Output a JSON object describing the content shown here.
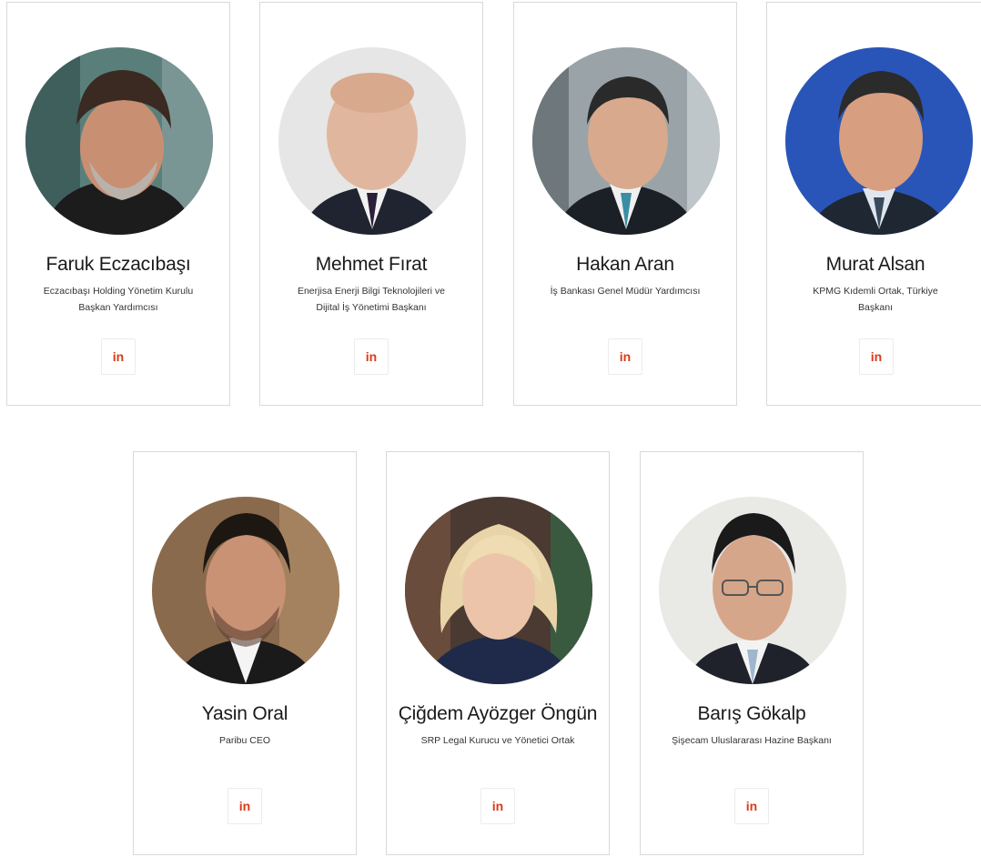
{
  "speakers": [
    {
      "name": "Faruk Eczacıbaşı",
      "title": "Eczacıbaşı Holding Yönetim Kurulu Başkan Yardımcısı",
      "linkedin_label": "in"
    },
    {
      "name": "Mehmet Fırat",
      "title": "Enerjisa Enerji Bilgi Teknolojileri ve Dijital İş Yönetimi Başkanı",
      "linkedin_label": "in"
    },
    {
      "name": "Hakan Aran",
      "title": "İş Bankası Genel Müdür Yardımcısı",
      "linkedin_label": "in"
    },
    {
      "name": "Murat Alsan",
      "title": "KPMG Kıdemli Ortak, Türkiye Başkanı",
      "linkedin_label": "in"
    },
    {
      "name": "Yasin Oral",
      "title": "Paribu CEO",
      "linkedin_label": "in"
    },
    {
      "name": "Çiğdem Ayözger Öngün",
      "title": "SRP Legal Kurucu ve Yönetici Ortak",
      "linkedin_label": "in"
    },
    {
      "name": "Barış Gökalp",
      "title": "Şişecam Uluslararası Hazine Başkanı",
      "linkedin_label": "in"
    }
  ],
  "colors": {
    "linkedin_accent": "#d93a1a",
    "card_border": "#d9d9d9"
  },
  "icons": {
    "linkedin": "linkedin-icon"
  }
}
